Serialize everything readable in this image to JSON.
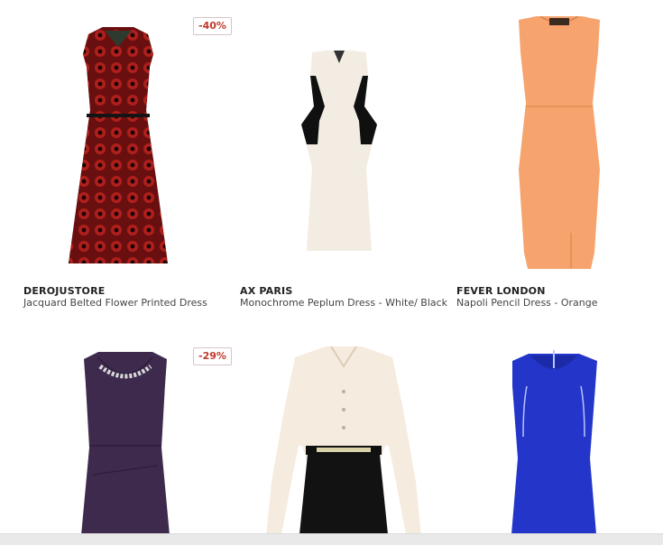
{
  "products": [
    {
      "brand": "DEROJUSTORE",
      "name": "Jacquard Belted Flower Printed Dress",
      "discount": "-40%",
      "color": "#8c1a1a"
    },
    {
      "brand": "AX PARIS",
      "name": "Monochrome Peplum Dress - White/ Black",
      "discount": "",
      "color": "#f3ece2"
    },
    {
      "brand": "FEVER LONDON",
      "name": "Napoli Pencil Dress - Orange",
      "discount": "",
      "color": "#f6a36e"
    },
    {
      "brand": "",
      "name": "",
      "discount": "-29%",
      "color": "#3d2a4d"
    },
    {
      "brand": "",
      "name": "",
      "discount": "",
      "color": "#f5ecdf"
    },
    {
      "brand": "",
      "name": "",
      "discount": "",
      "color": "#2336c9"
    }
  ]
}
